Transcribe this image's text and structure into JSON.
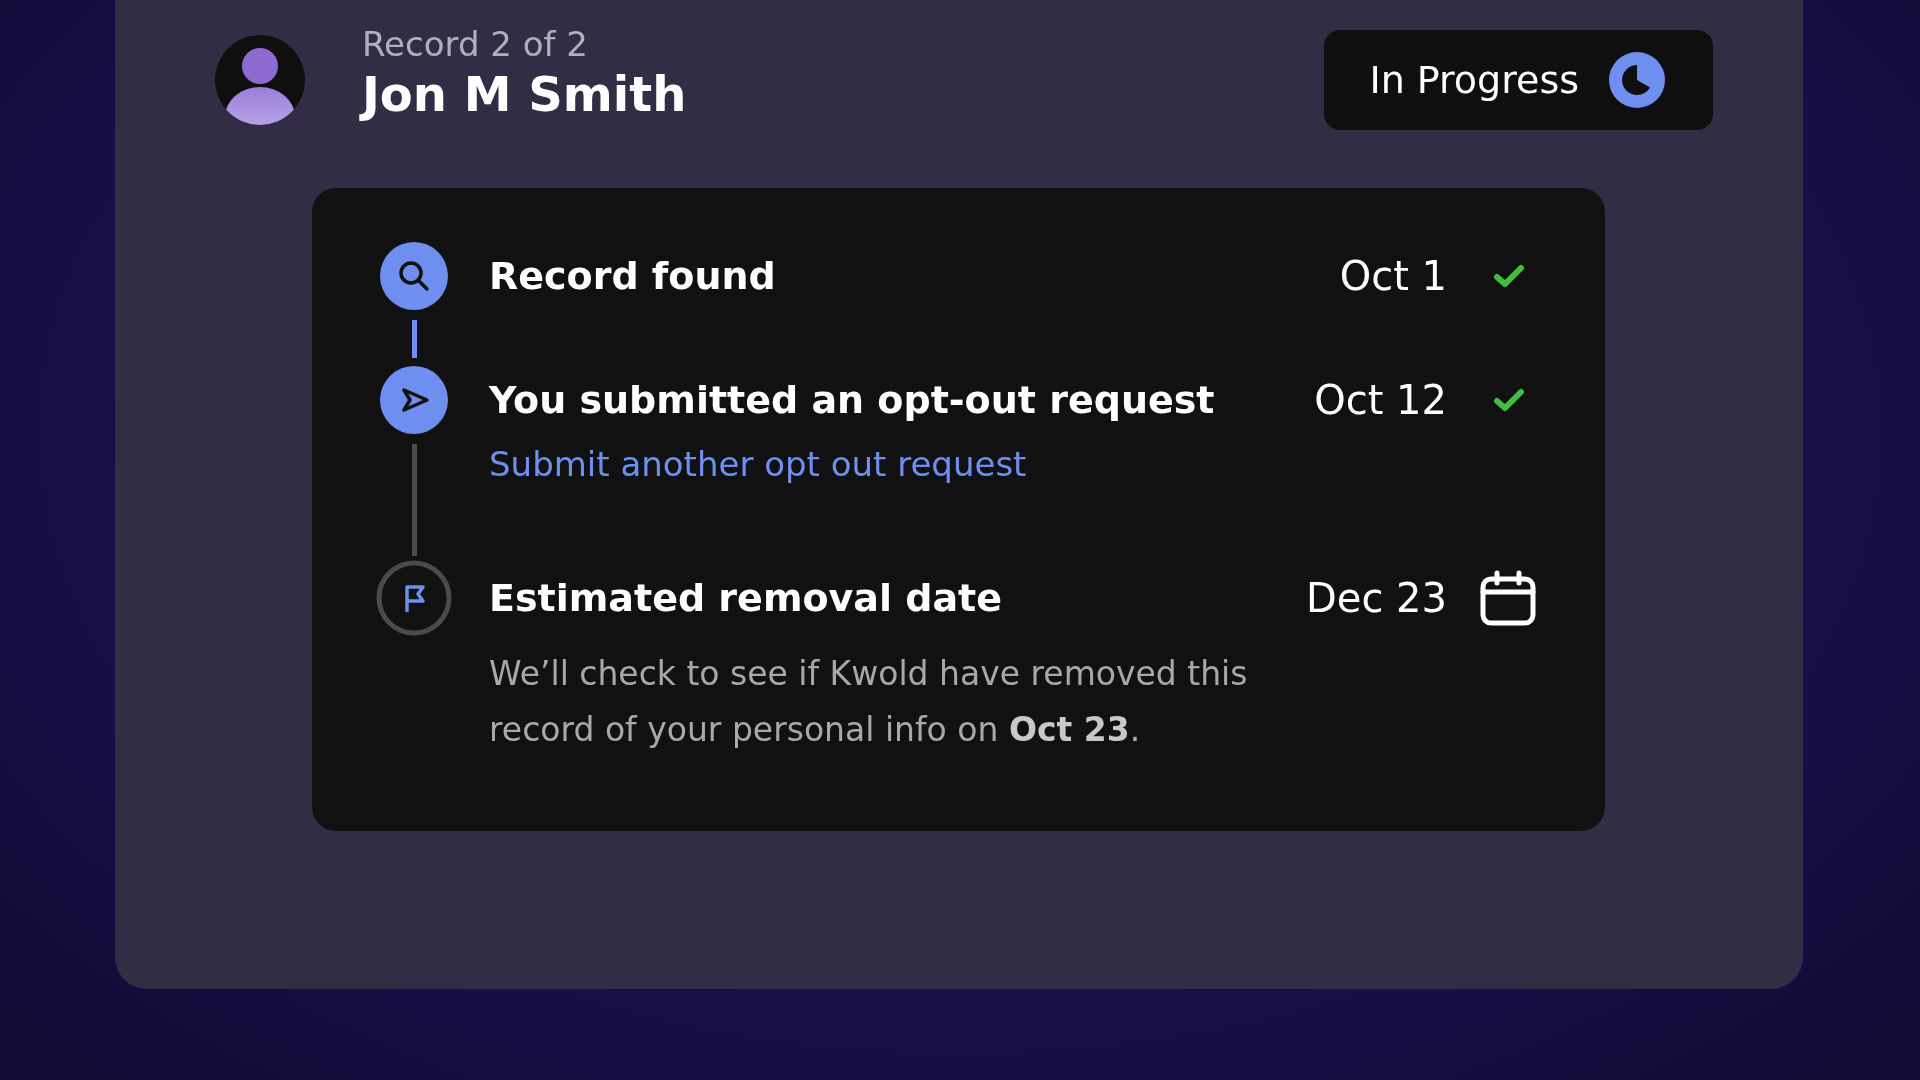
{
  "record": {
    "counter": "Record 2 of 2",
    "name": "Jon M Smith"
  },
  "status": {
    "label": "In Progress"
  },
  "steps": [
    {
      "title": "Record found",
      "date": "Oct 1",
      "completed": true
    },
    {
      "title": "You submitted an opt-out request",
      "date": "Oct 12",
      "completed": true,
      "link": "Submit another opt out request"
    },
    {
      "title": "Estimated removal date",
      "date": "Dec 23",
      "completed": false,
      "description": "We’ll check to see if Kwold have removed this record of your personal info on **Oct 23**."
    }
  ]
}
